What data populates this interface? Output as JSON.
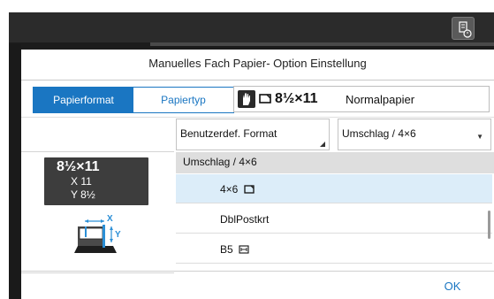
{
  "dialog": {
    "title": "Manuelles Fach Papier- Option Einstellung"
  },
  "tabs": [
    {
      "label": "Papierformat",
      "active": true
    },
    {
      "label": "Papiertyp",
      "active": false
    }
  ],
  "current": {
    "size": "8½×11",
    "type": "Normalpapier"
  },
  "dropdowns": {
    "format": "Benutzerdef. Format",
    "envelope": "Umschlag / 4×6"
  },
  "preview": {
    "size": "8½×11",
    "x": "X 11",
    "y": "Y 8½",
    "x_axis": "X",
    "y_axis": "Y"
  },
  "list": {
    "header": "Umschlag / 4×6",
    "items": [
      {
        "label": "4×6",
        "selected": true
      },
      {
        "label": "DblPostkrt",
        "selected": false
      },
      {
        "label": "B5",
        "selected": false
      }
    ]
  },
  "footer": {
    "ok_label": "OK"
  },
  "colors": {
    "accent": "#1a76c2",
    "top_bar": "#2b2b2b",
    "selected_row": "#dcedf9"
  }
}
